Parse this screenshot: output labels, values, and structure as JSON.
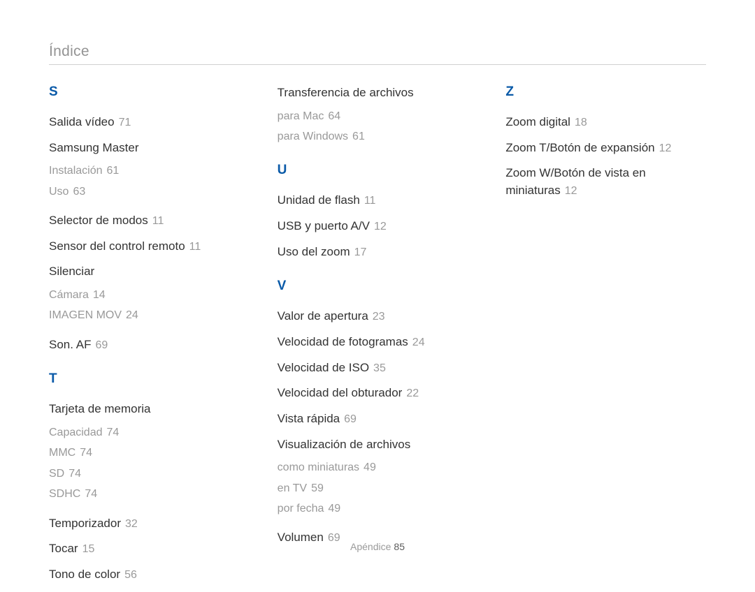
{
  "header": {
    "title": "Índice"
  },
  "columns": [
    {
      "groups": [
        {
          "letter": "S",
          "entries": [
            {
              "type": "main",
              "label": "Salida vídeo",
              "page": "71"
            },
            {
              "type": "main",
              "label": "Samsung Master",
              "subs": [
                {
                  "label": "Instalación",
                  "page": "61"
                },
                {
                  "label": "Uso",
                  "page": "63"
                }
              ]
            },
            {
              "type": "main",
              "label": "Selector de modos",
              "page": "11"
            },
            {
              "type": "main",
              "label": "Sensor del control remoto",
              "page": "11"
            },
            {
              "type": "main",
              "label": "Silenciar",
              "subs": [
                {
                  "label": "Cámara",
                  "page": "14"
                },
                {
                  "label": "IMAGEN MOV",
                  "page": "24"
                }
              ]
            },
            {
              "type": "main",
              "label": "Son. AF",
              "page": "69"
            }
          ]
        },
        {
          "letter": "T",
          "entries": [
            {
              "type": "main",
              "label": "Tarjeta de memoria",
              "subs": [
                {
                  "label": "Capacidad",
                  "page": "74"
                },
                {
                  "label": "MMC",
                  "page": "74"
                },
                {
                  "label": "SD",
                  "page": "74"
                },
                {
                  "label": "SDHC",
                  "page": "74"
                }
              ]
            },
            {
              "type": "main",
              "label": "Temporizador",
              "page": "32"
            },
            {
              "type": "main",
              "label": "Tocar",
              "page": "15"
            },
            {
              "type": "main",
              "label": "Tono de color",
              "page": "56"
            }
          ]
        }
      ]
    },
    {
      "groups": [
        {
          "letter": "",
          "entries": [
            {
              "type": "main",
              "label": "Transferencia de archivos",
              "subs": [
                {
                  "label": "para Mac",
                  "page": "64"
                },
                {
                  "label": "para Windows",
                  "page": "61"
                }
              ]
            }
          ]
        },
        {
          "letter": "U",
          "entries": [
            {
              "type": "main",
              "label": "Unidad de flash",
              "page": "11"
            },
            {
              "type": "main",
              "label": "USB y puerto A/V",
              "page": "12"
            },
            {
              "type": "main",
              "label": "Uso del zoom",
              "page": "17"
            }
          ]
        },
        {
          "letter": "V",
          "entries": [
            {
              "type": "main",
              "label": "Valor de apertura",
              "page": "23"
            },
            {
              "type": "main",
              "label": "Velocidad de fotogramas",
              "page": "24"
            },
            {
              "type": "main",
              "label": "Velocidad de ISO",
              "page": "35"
            },
            {
              "type": "main",
              "label": "Velocidad del obturador",
              "page": "22"
            },
            {
              "type": "main",
              "label": "Vista rápida",
              "page": "69"
            },
            {
              "type": "main",
              "label": "Visualización de archivos",
              "subs": [
                {
                  "label": "como miniaturas",
                  "page": "49"
                },
                {
                  "label": "en TV",
                  "page": "59"
                },
                {
                  "label": "por fecha",
                  "page": "49"
                }
              ]
            },
            {
              "type": "main",
              "label": "Volumen",
              "page": "69"
            }
          ]
        }
      ]
    },
    {
      "groups": [
        {
          "letter": "Z",
          "entries": [
            {
              "type": "main",
              "label": "Zoom digital",
              "page": "18"
            },
            {
              "type": "main",
              "label": "Zoom T/Botón de expansión",
              "page": "12"
            },
            {
              "type": "main",
              "label": "Zoom W/Botón de vista en miniaturas",
              "page": "12"
            }
          ]
        }
      ]
    }
  ],
  "footer": {
    "section": "Apéndice",
    "page": "85"
  }
}
